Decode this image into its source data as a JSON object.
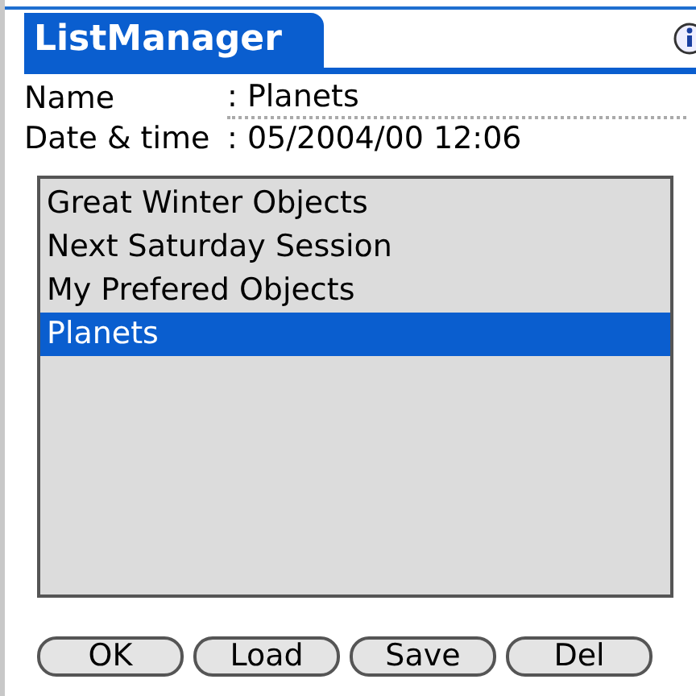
{
  "window": {
    "title": "ListManager"
  },
  "fields": [
    {
      "label": "Name",
      "value": ": Planets"
    },
    {
      "label": "Date & time",
      "value": ": 05/2004/00 12:06"
    }
  ],
  "list": {
    "items": [
      {
        "label": "Great Winter Objects",
        "selected": false
      },
      {
        "label": "Next Saturday Session",
        "selected": false
      },
      {
        "label": "My Prefered Objects",
        "selected": false
      },
      {
        "label": "Planets",
        "selected": true
      }
    ]
  },
  "buttons": [
    "OK",
    "Load",
    "Save",
    "Del"
  ]
}
